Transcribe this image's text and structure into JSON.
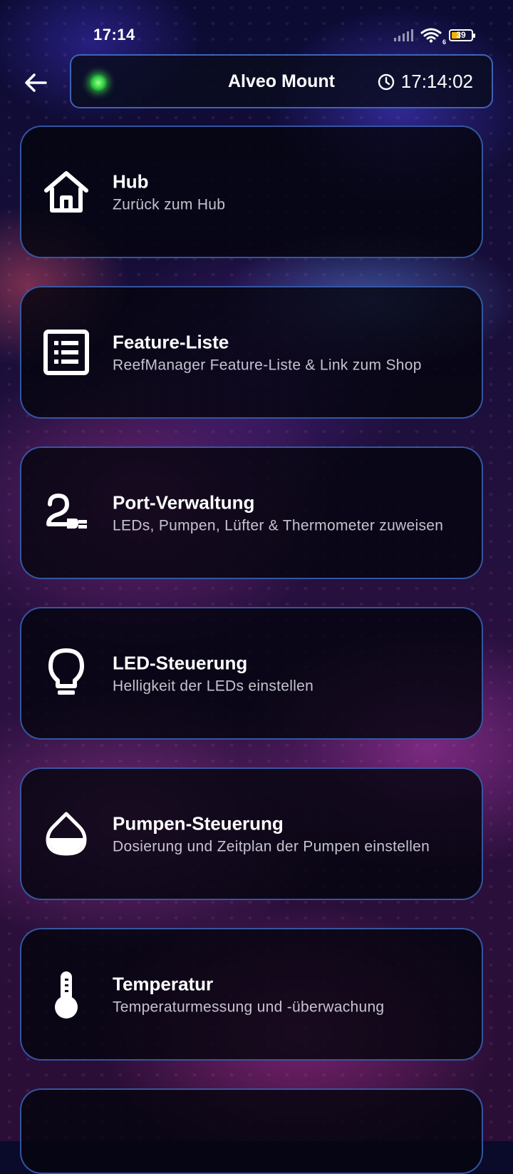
{
  "status_bar": {
    "time": "17:14",
    "battery_percent": "39",
    "wifi_badge": "6"
  },
  "header": {
    "device_name": "Alveo Mount",
    "clock": "17:14:02",
    "connection_status_color": "#33d24a"
  },
  "menu": [
    {
      "title": "Hub",
      "subtitle": "Zurück zum Hub",
      "icon": "home-icon"
    },
    {
      "title": "Feature-Liste",
      "subtitle": "ReefManager Feature-Liste & Link zum Shop",
      "icon": "list-icon"
    },
    {
      "title": "Port-Verwaltung",
      "subtitle": "LEDs, Pumpen, Lüfter & Thermometer zuweisen",
      "icon": "plug-icon"
    },
    {
      "title": "LED-Steuerung",
      "subtitle": "Helligkeit der LEDs einstellen",
      "icon": "lightbulb-icon"
    },
    {
      "title": "Pumpen-Steuerung",
      "subtitle": "Dosierung und Zeitplan der Pumpen einstellen",
      "icon": "drop-icon"
    },
    {
      "title": "Temperatur",
      "subtitle": "Temperaturmessung und -überwachung",
      "icon": "thermometer-icon"
    }
  ],
  "colors": {
    "card_border": "#4678dc",
    "accent_green": "#33d24a"
  }
}
